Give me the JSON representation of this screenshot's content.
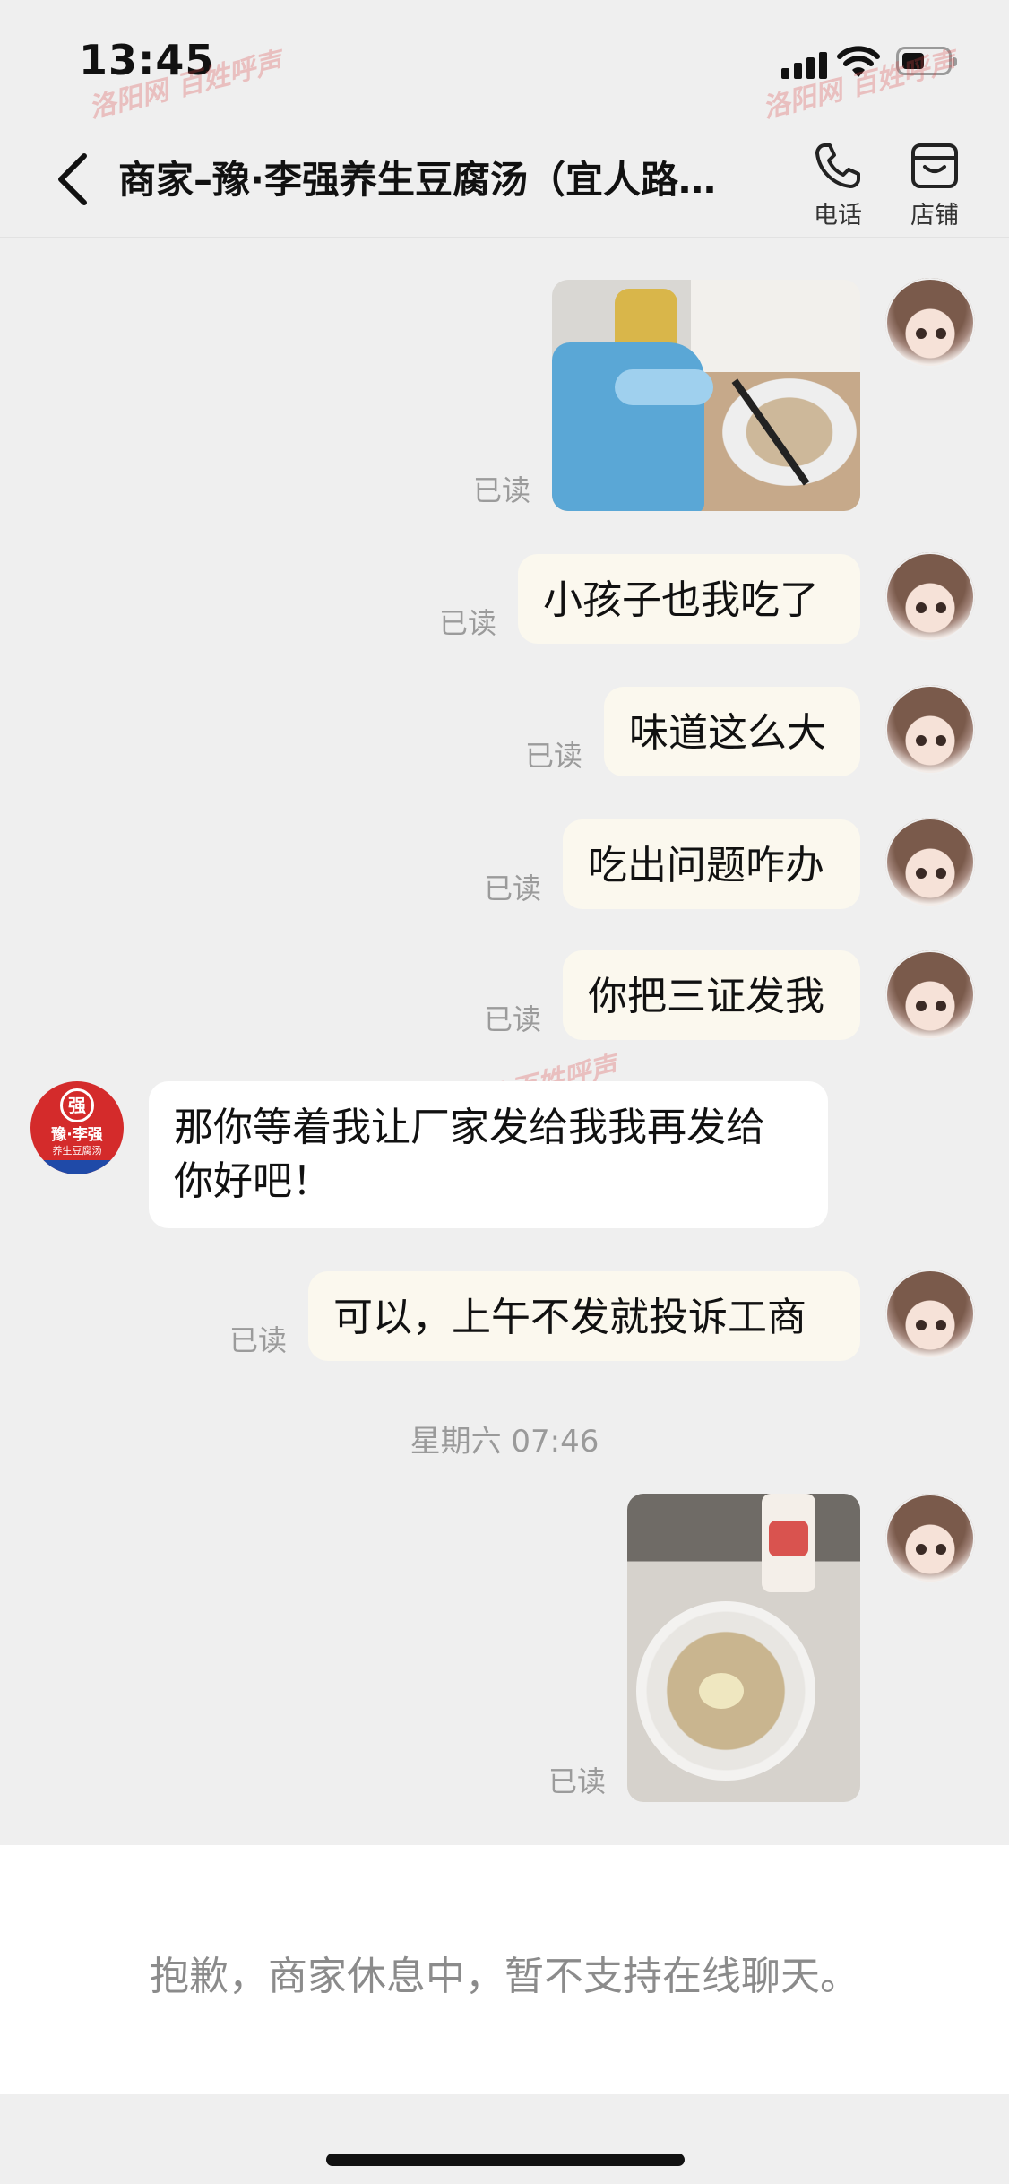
{
  "status_bar": {
    "time": "13:45"
  },
  "header": {
    "back_icon": "chevron-left-icon",
    "title": "商家–豫·李强养生豆腐汤（宜人路…",
    "phone": {
      "icon": "phone-icon",
      "label": "电话"
    },
    "store": {
      "icon": "store-icon",
      "label": "店铺"
    }
  },
  "messages": [
    {
      "type": "image",
      "sender": "me",
      "status": "已读"
    },
    {
      "type": "text",
      "sender": "me",
      "text": "小孩子也我吃了",
      "status": "已读"
    },
    {
      "type": "text",
      "sender": "me",
      "text": "味道这么大",
      "status": "已读"
    },
    {
      "type": "text",
      "sender": "me",
      "text": "吃出问题咋办",
      "status": "已读"
    },
    {
      "type": "text",
      "sender": "me",
      "text": "你把三证发我",
      "status": "已读"
    },
    {
      "type": "text",
      "sender": "merchant",
      "text": "那你等着我让厂家发给我我再发给你好吧！"
    },
    {
      "type": "text",
      "sender": "me",
      "text": "可以，上午不发就投诉工商",
      "status": "已读"
    },
    {
      "type": "image",
      "sender": "me",
      "status": "已读"
    }
  ],
  "timestamp": "星期六 07:46",
  "merchant_avatar": {
    "seal": "强",
    "name": "豫·李强",
    "sub": "养生豆腐汤"
  },
  "bottom_notice": "抱歉，商家休息中，暂不支持在线聊天。",
  "watermark": "洛阳网 百姓呼声",
  "colors": {
    "background": "#efefef",
    "outgoing_bubble": "#fbf8ee",
    "incoming_bubble": "#ffffff",
    "read_text": "#9b9b9b"
  }
}
